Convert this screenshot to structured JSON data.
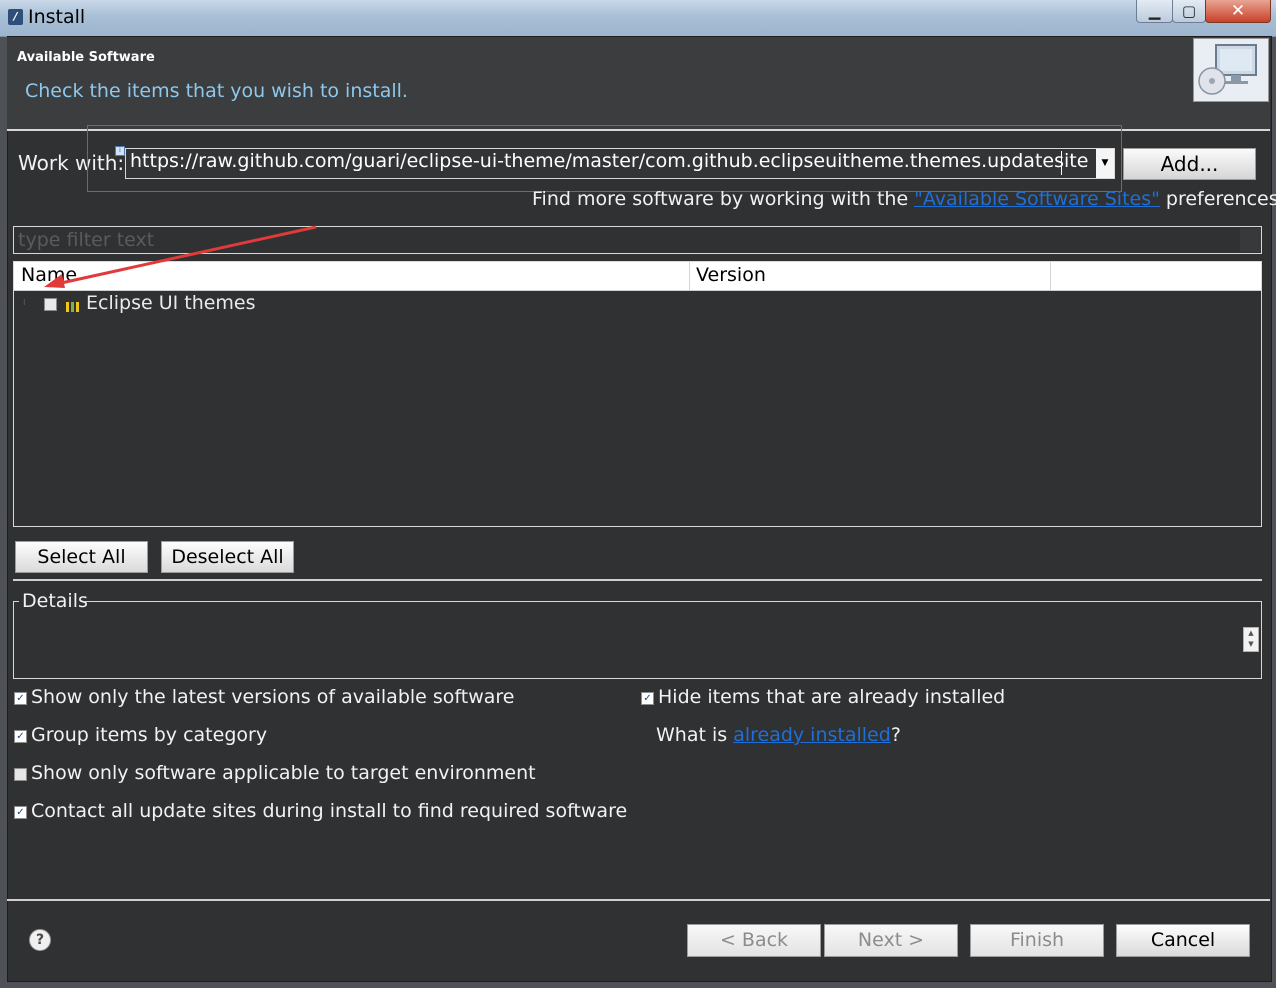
{
  "window": {
    "title": "Install",
    "minimize_glyph": "▁",
    "maximize_glyph": "▢",
    "close_glyph": "✕"
  },
  "header": {
    "title": "Available Software",
    "subtitle": "Check the items that you wish to install."
  },
  "work_with": {
    "label": "Work with:",
    "value": "https://raw.github.com/guari/eclipse-ui-theme/master/com.github.eclipseuitheme.themes.updatesite",
    "add_button": "Add..."
  },
  "find_more": {
    "prefix": "Find more software by working with the ",
    "link": "\"Available Software Sites\"",
    "suffix": " preferences."
  },
  "filter": {
    "placeholder": "type filter text"
  },
  "tree": {
    "columns": [
      "Name",
      "Version"
    ],
    "items": [
      {
        "label": "Eclipse UI themes",
        "checked": false,
        "expand_glyph": "⁝"
      }
    ]
  },
  "buttons": {
    "select_all": "Select All",
    "deselect_all": "Deselect All"
  },
  "details": {
    "label": "Details",
    "scroll_up": "▲",
    "scroll_down": "▼"
  },
  "options": {
    "show_latest": {
      "label": "Show only the latest versions of available software",
      "checked": true
    },
    "group_by_category": {
      "label": "Group items by category",
      "checked": true
    },
    "applicable_only": {
      "label": "Show only software applicable to target environment",
      "checked": false
    },
    "contact_all_sites": {
      "label": "Contact all update sites during install to find required software",
      "checked": true
    },
    "hide_installed": {
      "label": "Hide items that are already installed",
      "checked": true
    }
  },
  "already_installed": {
    "prefix": "What is ",
    "link": "already installed",
    "suffix": "?"
  },
  "footer": {
    "help_glyph": "?",
    "back": "< Back",
    "next": "Next >",
    "finish": "Finish",
    "cancel": "Cancel"
  },
  "colors": {
    "accent_link": "#1e6fd8",
    "subtitle": "#8ec8ec",
    "annotation_red": "#e03a3a",
    "dialog_bg": "#2f3132"
  }
}
